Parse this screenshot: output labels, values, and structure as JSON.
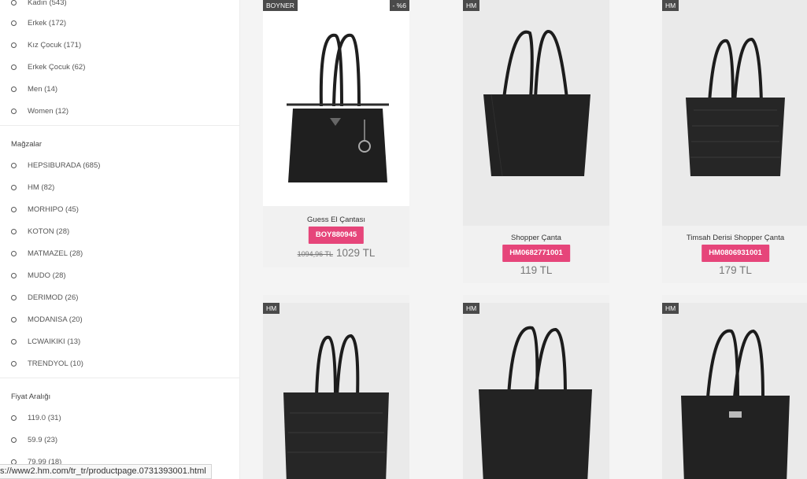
{
  "filters": {
    "category_options": [
      {
        "label": "Kadın (543)"
      },
      {
        "label": "Erkek (172)"
      },
      {
        "label": "Kız Çocuk (171)"
      },
      {
        "label": "Erkek Çocuk (62)"
      },
      {
        "label": "Men (14)"
      },
      {
        "label": "Women (12)"
      }
    ],
    "stores_heading": "Mağzalar",
    "store_options": [
      {
        "label": "HEPSIBURADA (685)"
      },
      {
        "label": "HM (82)"
      },
      {
        "label": "MORHIPO (45)"
      },
      {
        "label": "KOTON (28)"
      },
      {
        "label": "MATMAZEL (28)"
      },
      {
        "label": "MUDO (28)"
      },
      {
        "label": "DERIMOD (26)"
      },
      {
        "label": "MODANISA (20)"
      },
      {
        "label": "LCWAIKIKI (13)"
      },
      {
        "label": "TRENDYOL (10)"
      }
    ],
    "price_heading": "Fiyat Aralığı",
    "price_options": [
      {
        "label": "119.0 (31)"
      },
      {
        "label": "59.9 (23)"
      },
      {
        "label": "79.99 (18)"
      }
    ]
  },
  "products": [
    {
      "store": "BOYNER",
      "discount": "- %6",
      "name": "Guess El Çantası",
      "code": "BOY880945",
      "old_price": "1094,96 TL",
      "price": "1029 TL"
    },
    {
      "store": "HM",
      "name": "Shopper Çanta",
      "code": "HM0682771001",
      "price": "119 TL"
    },
    {
      "store": "HM",
      "name": "Timsah Derisi Shopper Çanta",
      "code": "HM0806931001",
      "price": "179 TL"
    },
    {
      "store": "HM"
    },
    {
      "store": "HM"
    },
    {
      "store": "HM"
    }
  ],
  "status_url": "s://www2.hm.com/tr_tr/productpage.0731393001.html",
  "colors": {
    "accent": "#e6457a",
    "badge": "#4a4a4a",
    "bag": "#1f1f1f"
  }
}
